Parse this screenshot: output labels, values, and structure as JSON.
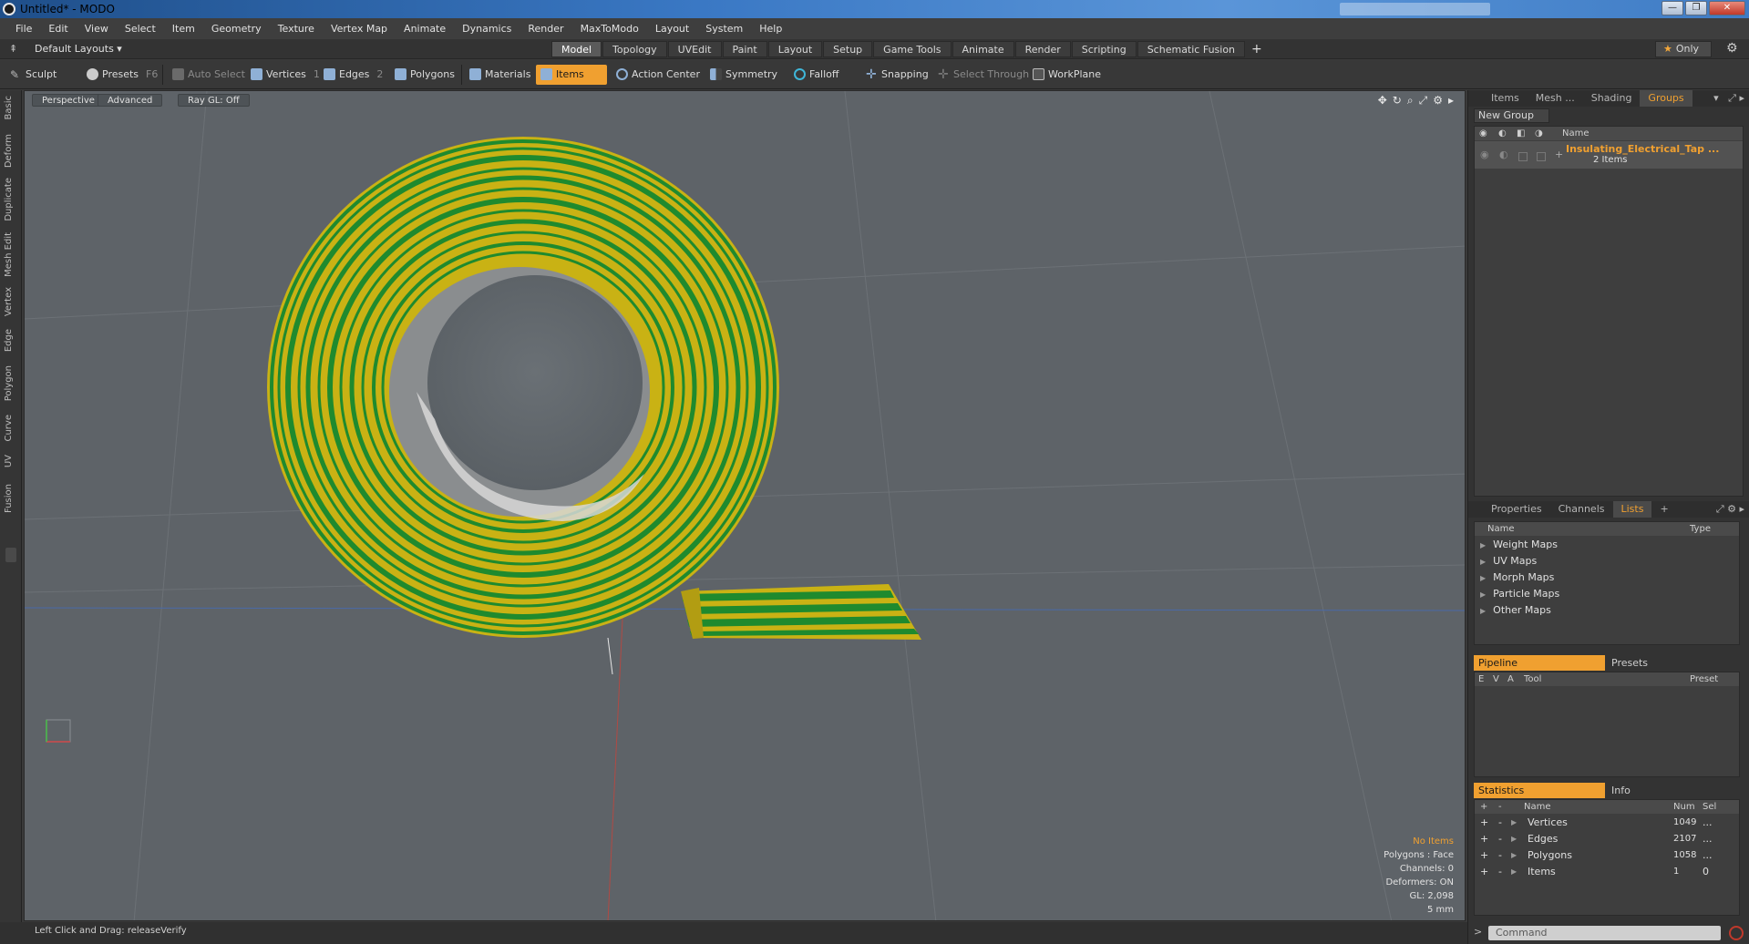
{
  "window": {
    "title": "Untitled* - MODO",
    "controls": [
      "—",
      "❐",
      "✕"
    ]
  },
  "menu": [
    "File",
    "Edit",
    "View",
    "Select",
    "Item",
    "Geometry",
    "Texture",
    "Vertex Map",
    "Animate",
    "Dynamics",
    "Render",
    "MaxToModo",
    "Layout",
    "System",
    "Help"
  ],
  "layout": {
    "selector": "Default Layouts ▾",
    "tabs": [
      "Model",
      "Topology",
      "UVEdit",
      "Paint",
      "Layout",
      "Setup",
      "Game Tools",
      "Animate",
      "Render",
      "Scripting",
      "Schematic Fusion"
    ],
    "active_tab": "Model",
    "only_label": "Only"
  },
  "toolbar": {
    "sculpt": "Sculpt",
    "presets": "Presets",
    "presets_key": "F6",
    "auto_select": "Auto Select",
    "vertices": "Vertices",
    "vertices_num": "1",
    "edges": "Edges",
    "edges_num": "2",
    "polygons": "Polygons",
    "materials": "Materials",
    "items": "Items",
    "action_center": "Action Center",
    "symmetry": "Symmetry",
    "falloff": "Falloff",
    "snapping": "Snapping",
    "select_through": "Select Through",
    "workplane": "WorkPlane"
  },
  "left_tabs": [
    "Basic",
    "Deform",
    "Duplicate",
    "Mesh Edit",
    "Vertex",
    "Edge",
    "Polygon",
    "Curve",
    "UV",
    "Fusion"
  ],
  "viewport": {
    "perspective": "Perspective",
    "advanced": "Advanced",
    "raygl": "Ray GL: Off",
    "stats": {
      "items": "No Items",
      "polygons": "Polygons : Face",
      "channels": "Channels: 0",
      "deformers": "Deformers: ON",
      "gl": "GL: 2,098",
      "scale": "5 mm"
    },
    "colors": {
      "background": "#5e6368",
      "tape_green": "#1f8a2e",
      "tape_yellow": "#c9b214"
    }
  },
  "status": {
    "text": "Left Click and Drag:  releaseVerify"
  },
  "groups_panel": {
    "tabs": [
      "Items",
      "Mesh ...",
      "Shading",
      "Groups"
    ],
    "active_tab": "Groups",
    "new_group": "New Group",
    "col_name": "Name",
    "group_name": "Insulating_Electrical_Tap ...",
    "group_count": "2 Items"
  },
  "lists_panel": {
    "tabs": [
      "Properties",
      "Channels",
      "Lists"
    ],
    "active_tab": "Lists",
    "col_name": "Name",
    "col_type": "Type",
    "rows": [
      "Weight Maps",
      "UV Maps",
      "Morph Maps",
      "Particle Maps",
      "Other Maps"
    ]
  },
  "pipeline_panel": {
    "tab_pipeline": "Pipeline",
    "tab_presets": "Presets",
    "cols": [
      "E",
      "V",
      "A",
      "Tool",
      "Preset"
    ]
  },
  "stats_panel": {
    "tab_statistics": "Statistics",
    "tab_info": "Info",
    "cols": [
      "+",
      "-",
      "Name",
      "Num",
      "Sel"
    ],
    "rows": [
      {
        "name": "Vertices",
        "num": "1049",
        "sel": "..."
      },
      {
        "name": "Edges",
        "num": "2107",
        "sel": "..."
      },
      {
        "name": "Polygons",
        "num": "1058",
        "sel": "..."
      },
      {
        "name": "Items",
        "num": "1",
        "sel": "0"
      }
    ]
  },
  "command": {
    "placeholder": "Command",
    "prompt": ">"
  }
}
